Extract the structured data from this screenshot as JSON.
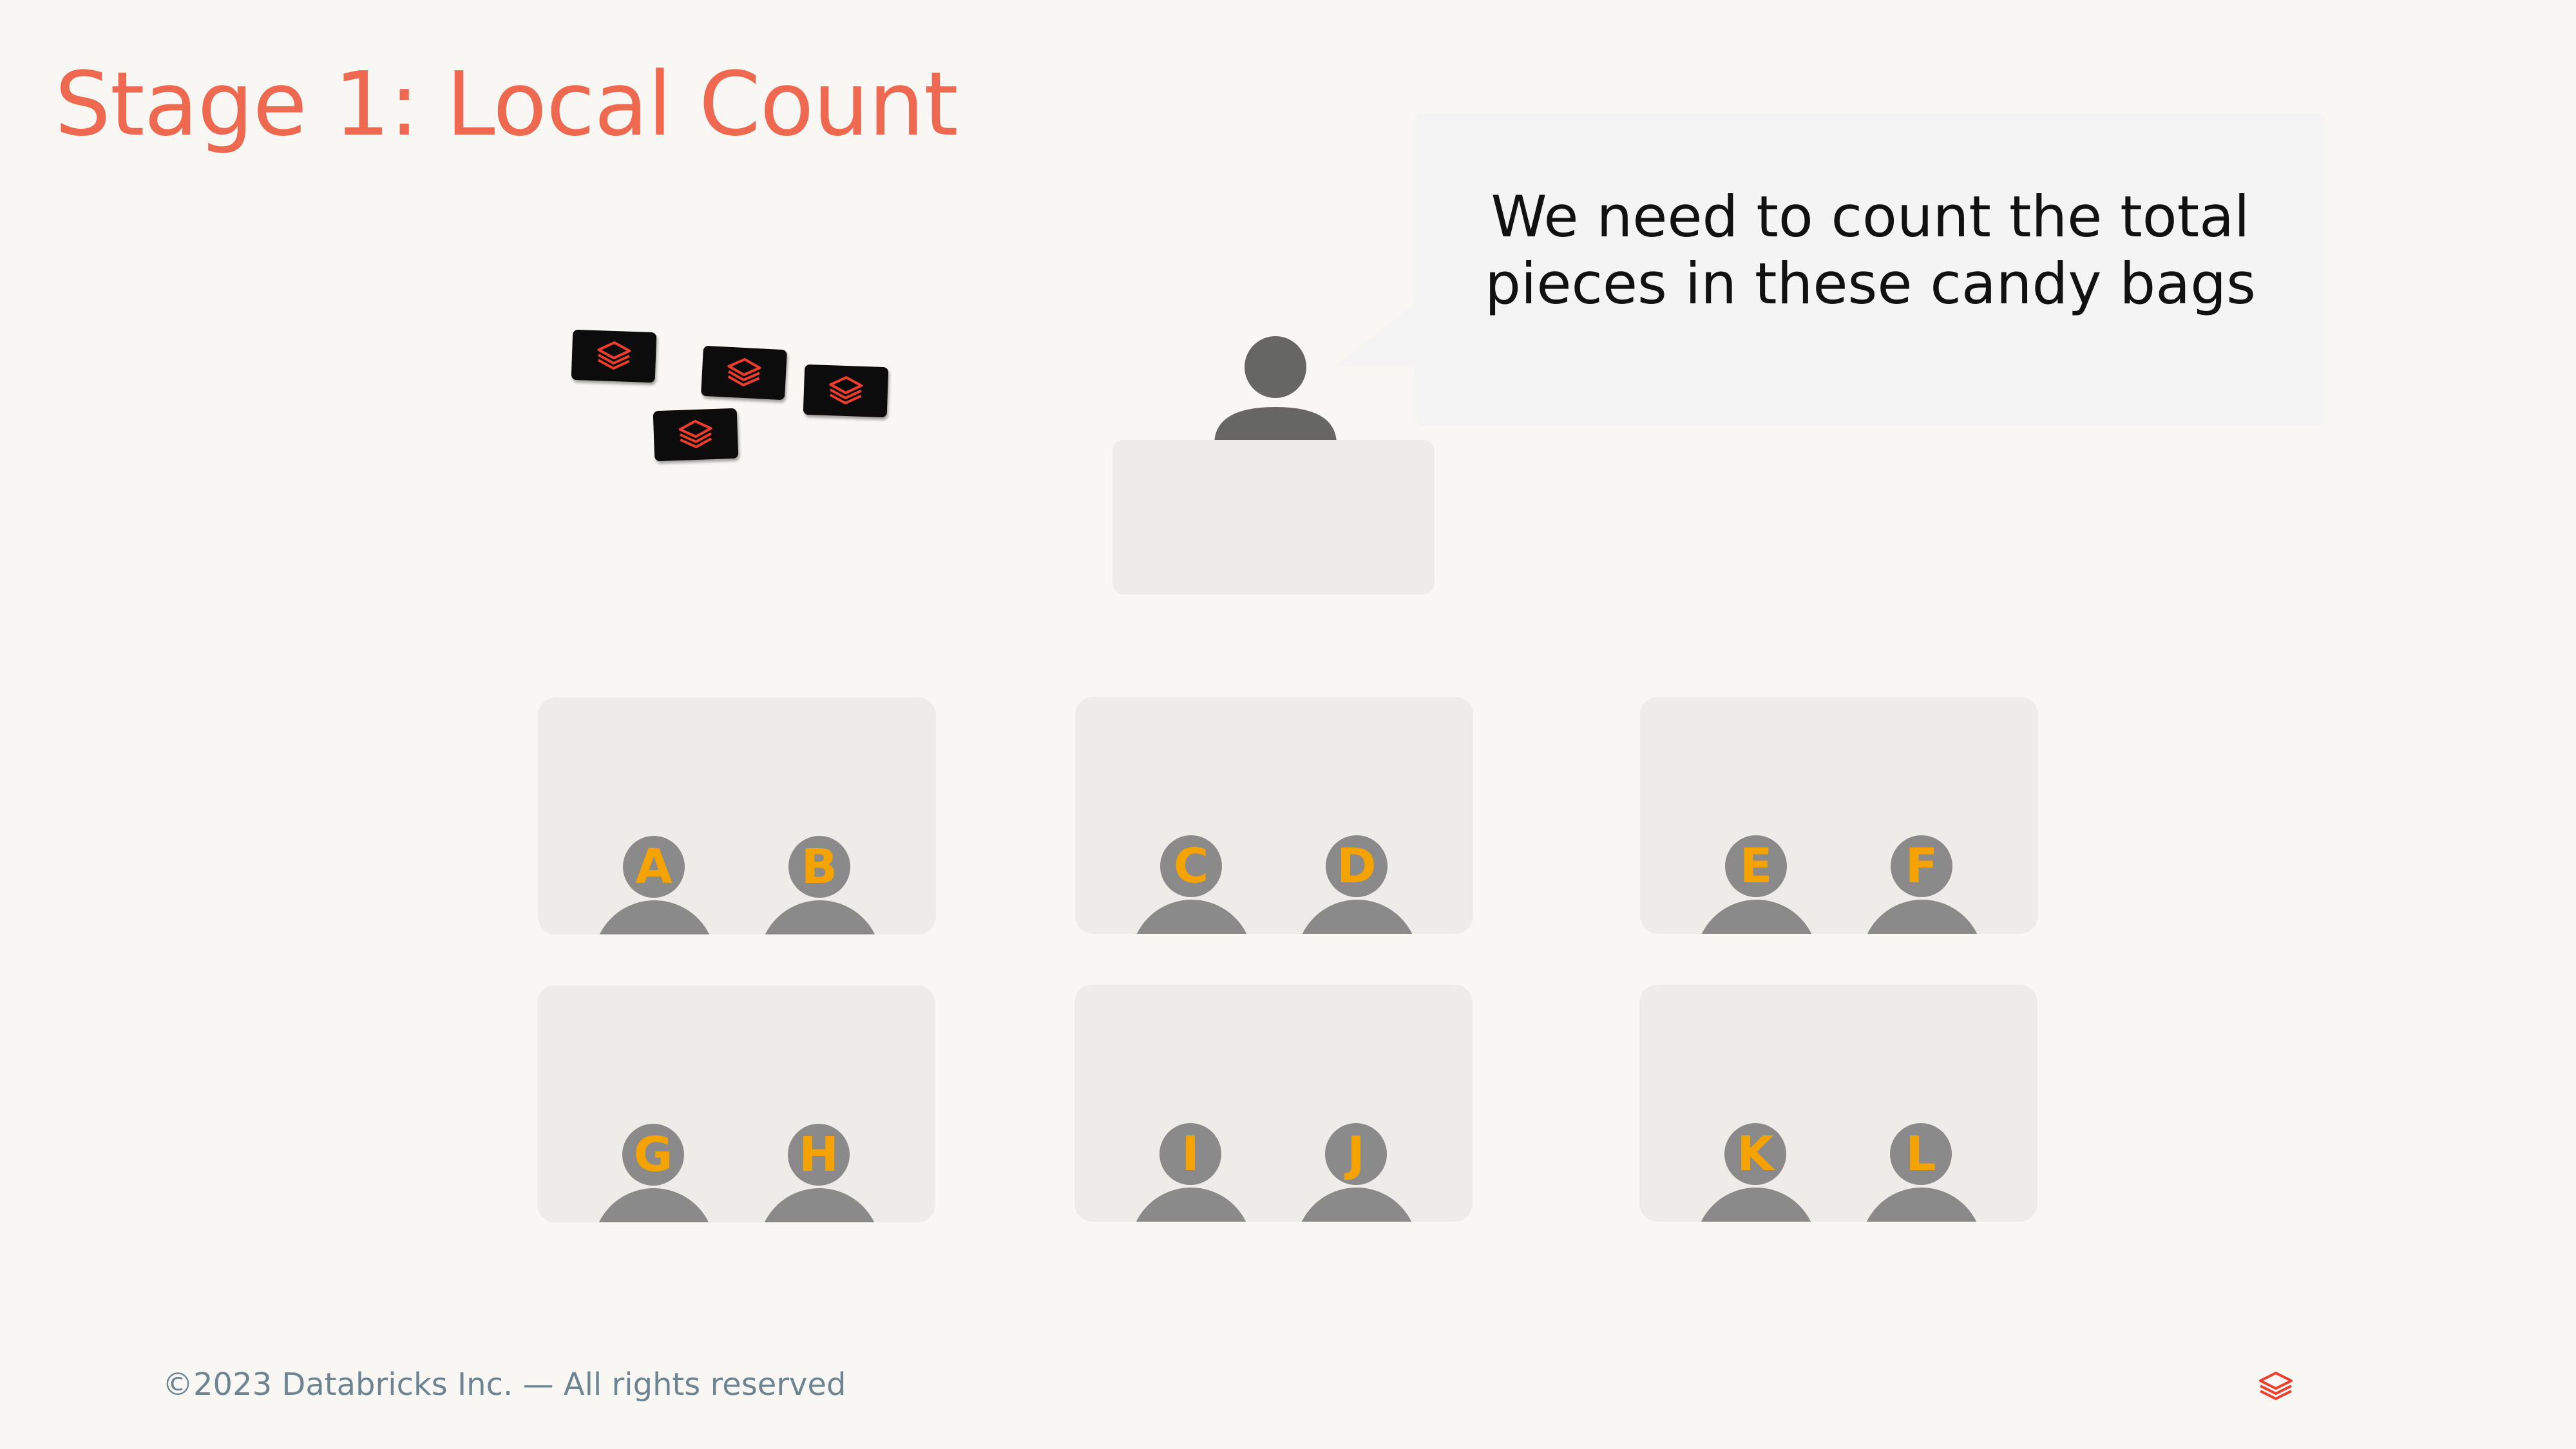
{
  "slide": {
    "title": "Stage 1: Local Count",
    "speech_bubble": "We need to count the total\npieces in these candy bags",
    "footer": "©2023 Databricks Inc. — All rights reserved"
  },
  "candy_bags": [
    {
      "icon": "databricks-logo-icon"
    },
    {
      "icon": "databricks-logo-icon"
    },
    {
      "icon": "databricks-logo-icon"
    },
    {
      "icon": "databricks-logo-icon"
    }
  ],
  "desks": [
    {
      "students": [
        "A",
        "B"
      ]
    },
    {
      "students": [
        "C",
        "D"
      ]
    },
    {
      "students": [
        "E",
        "F"
      ]
    },
    {
      "students": [
        "G",
        "H"
      ]
    },
    {
      "students": [
        "I",
        "J"
      ]
    },
    {
      "students": [
        "K",
        "L"
      ]
    }
  ],
  "colors": {
    "title": "#EE6950",
    "student_letter": "#F5A300",
    "student_figure": "#8A8A8A",
    "speaker_figure": "#666662",
    "desk": "#EDECE8",
    "background": "#F8F7F4",
    "bag": "#0C0C0C",
    "logo": "#EE3D2C"
  }
}
